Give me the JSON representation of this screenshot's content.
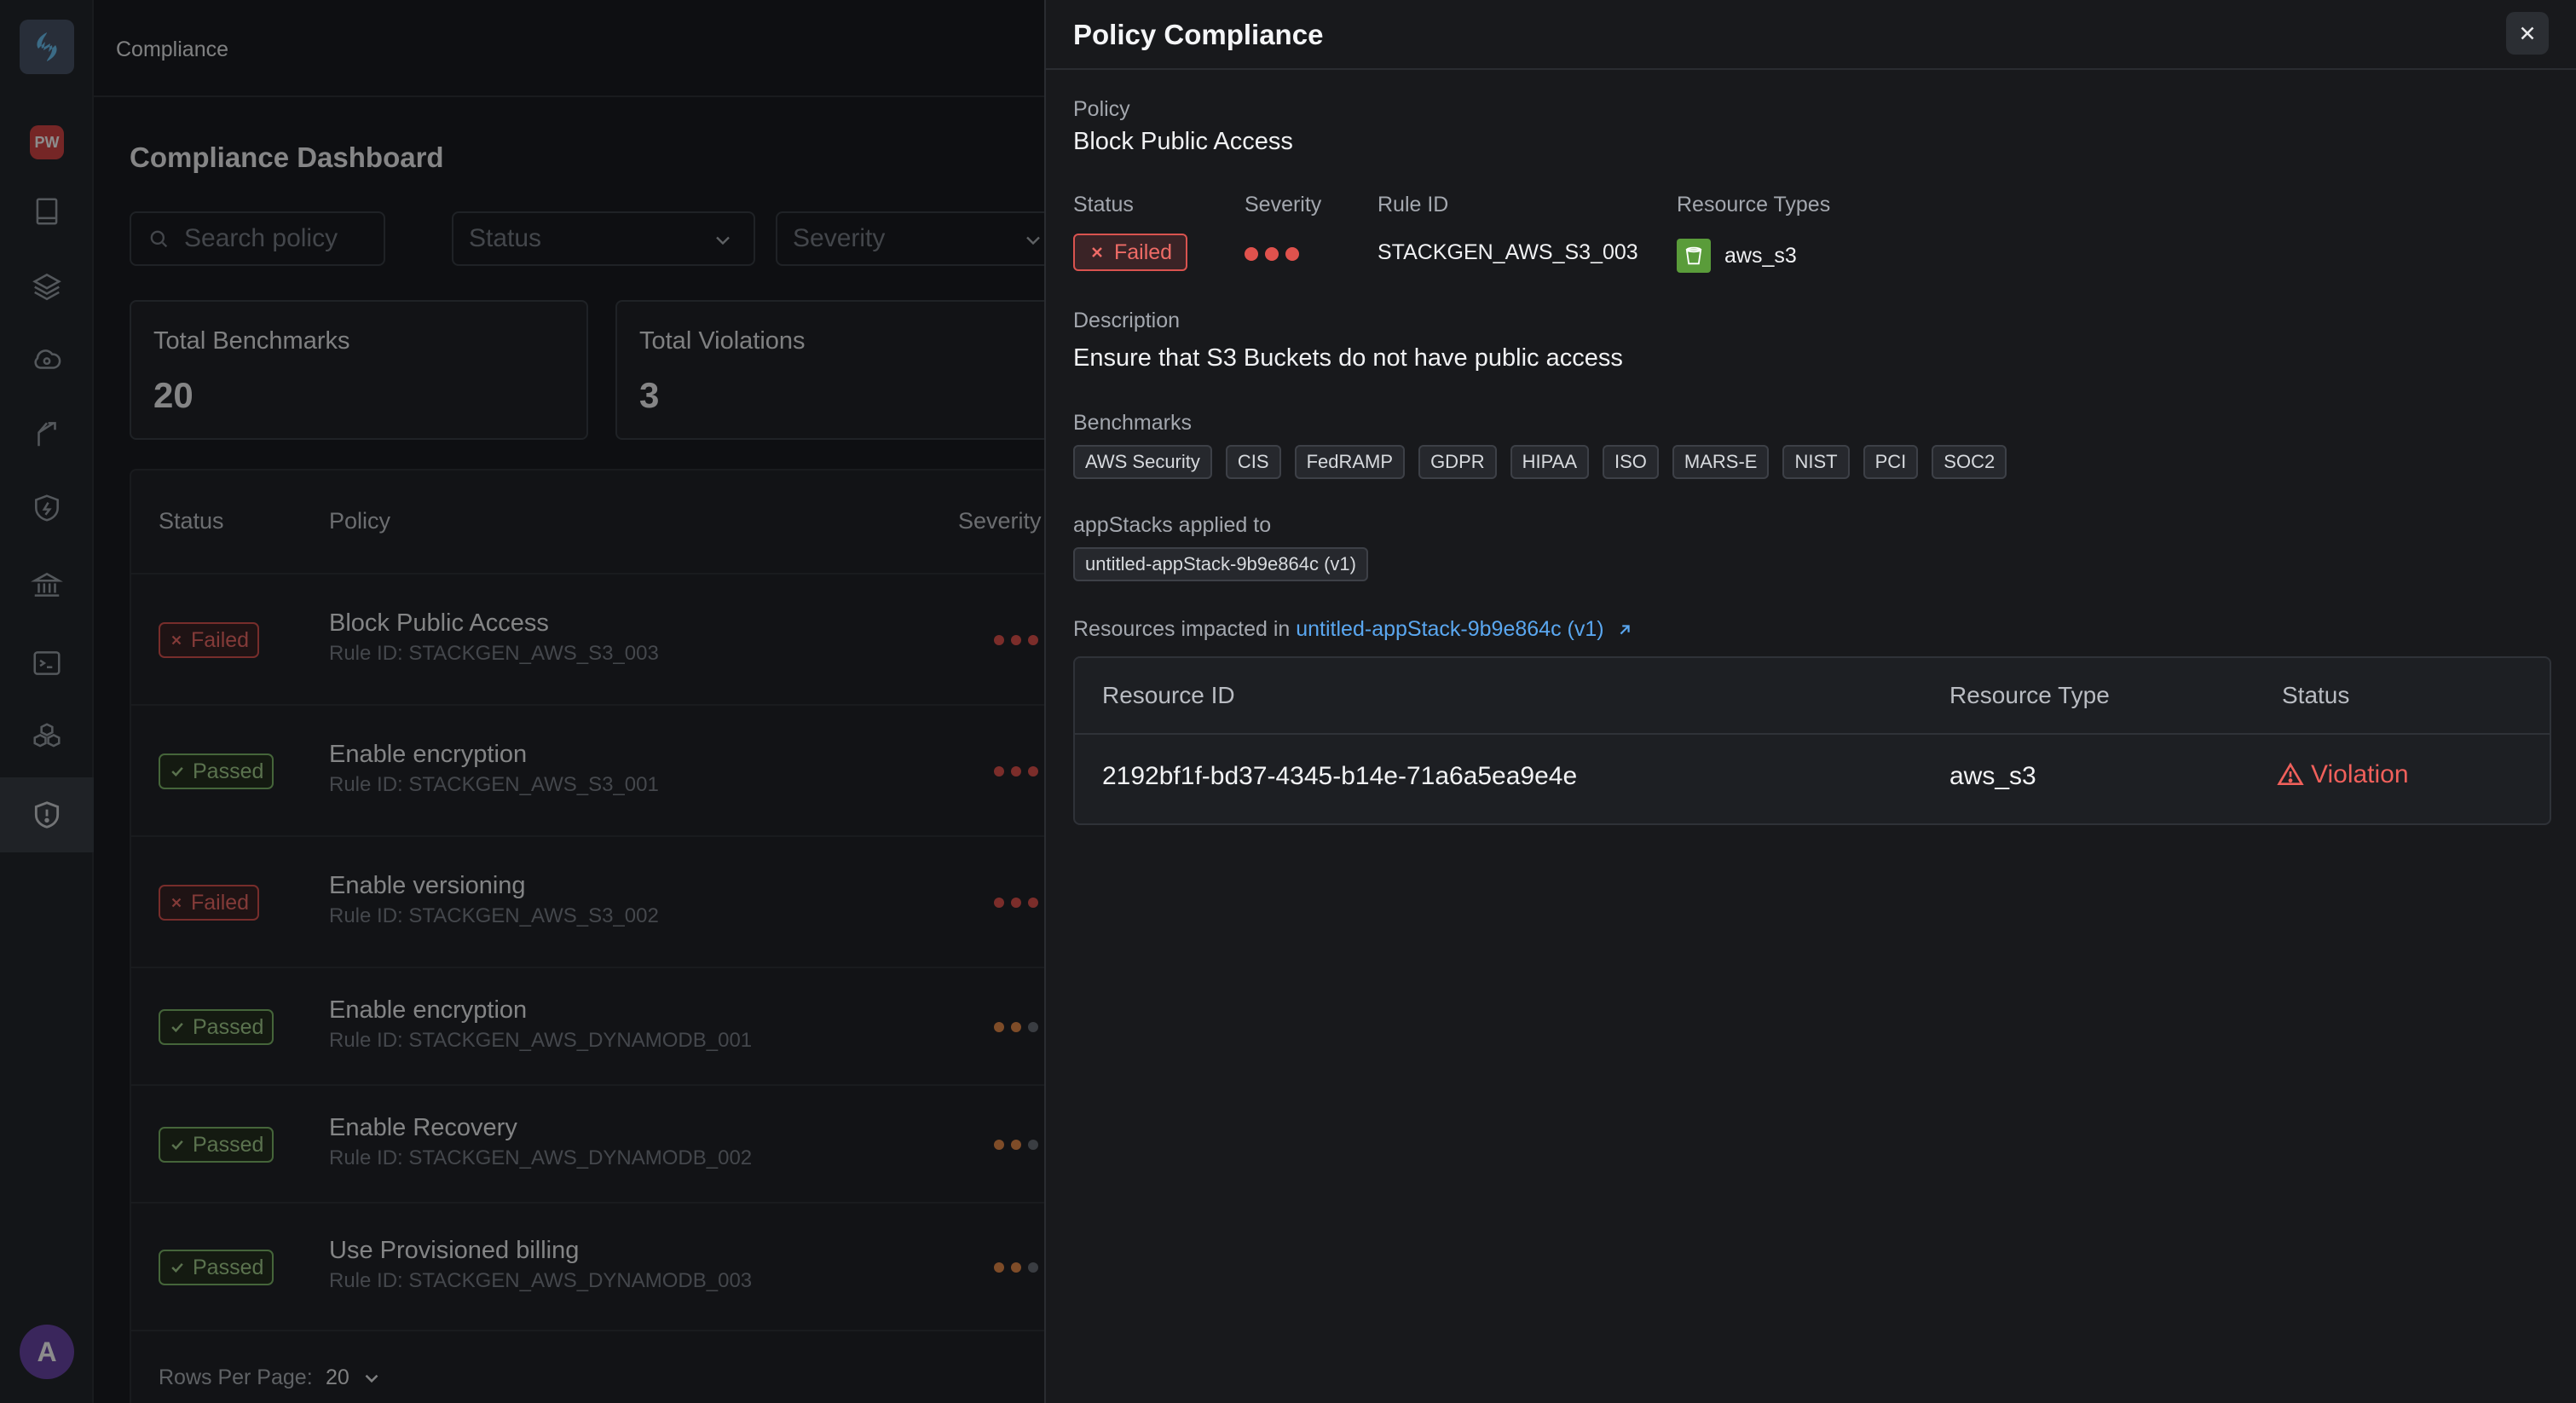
{
  "topbar": {
    "title": "Compliance"
  },
  "sidebar": {
    "pw_badge": "PW",
    "avatar": "A"
  },
  "dashboard": {
    "title": "Compliance Dashboard",
    "search_placeholder": "Search policy",
    "filter_status": "Status",
    "filter_severity": "Severity",
    "cards": [
      {
        "label": "Total Benchmarks",
        "value": "20"
      },
      {
        "label": "Total Violations",
        "value": "3"
      }
    ],
    "columns": {
      "status": "Status",
      "policy": "Policy",
      "severity": "Severity"
    },
    "rows": [
      {
        "status": "Failed",
        "name": "Block Public Access",
        "rule": "Rule ID: STACKGEN_AWS_S3_003",
        "severity_level": 3
      },
      {
        "status": "Passed",
        "name": "Enable encryption",
        "rule": "Rule ID: STACKGEN_AWS_S3_001",
        "severity_level": 3
      },
      {
        "status": "Failed",
        "name": "Enable versioning",
        "rule": "Rule ID: STACKGEN_AWS_S3_002",
        "severity_level": 3
      },
      {
        "status": "Passed",
        "name": "Enable encryption",
        "rule": "Rule ID: STACKGEN_AWS_DYNAMODB_001",
        "severity_level": 2
      },
      {
        "status": "Passed",
        "name": "Enable Recovery",
        "rule": "Rule ID: STACKGEN_AWS_DYNAMODB_002",
        "severity_level": 2
      },
      {
        "status": "Passed",
        "name": "Use Provisioned billing",
        "rule": "Rule ID: STACKGEN_AWS_DYNAMODB_003",
        "severity_level": 2
      }
    ],
    "rows_per_page_label": "Rows Per Page:",
    "rows_per_page_value": "20"
  },
  "drawer": {
    "title": "Policy Compliance",
    "policy_label": "Policy",
    "policy_value": "Block Public Access",
    "status_label": "Status",
    "status_value": "Failed",
    "severity_label": "Severity",
    "severity_level": 3,
    "rule_label": "Rule ID",
    "rule_value": "STACKGEN_AWS_S3_003",
    "resource_types_label": "Resource Types",
    "resource_type_value": "aws_s3",
    "description_label": "Description",
    "description_value": "Ensure that S3 Buckets do not have public access",
    "benchmarks_label": "Benchmarks",
    "benchmarks": [
      "AWS Security",
      "CIS",
      "FedRAMP",
      "GDPR",
      "HIPAA",
      "ISO",
      "MARS-E",
      "NIST",
      "PCI",
      "SOC2"
    ],
    "appstacks_label": "appStacks applied to",
    "appstack_chip": "untitled-appStack-9b9e864c (v1)",
    "impacted_prefix": "Resources impacted in",
    "impacted_link": "untitled-appStack-9b9e864c (v1)",
    "resources_columns": {
      "id": "Resource ID",
      "type": "Resource Type",
      "status": "Status"
    },
    "resources": [
      {
        "id": "2192bf1f-bd37-4345-b14e-71a6a5ea9e4e",
        "type": "aws_s3",
        "status": "Violation"
      }
    ]
  },
  "colors": {
    "failed": "#ee6b66",
    "passed": "#a4d08e",
    "severity_high": "#e0524d",
    "severity_medium": "#e58a4a",
    "severity_empty": "#6b7078",
    "link": "#5aa7f0"
  }
}
